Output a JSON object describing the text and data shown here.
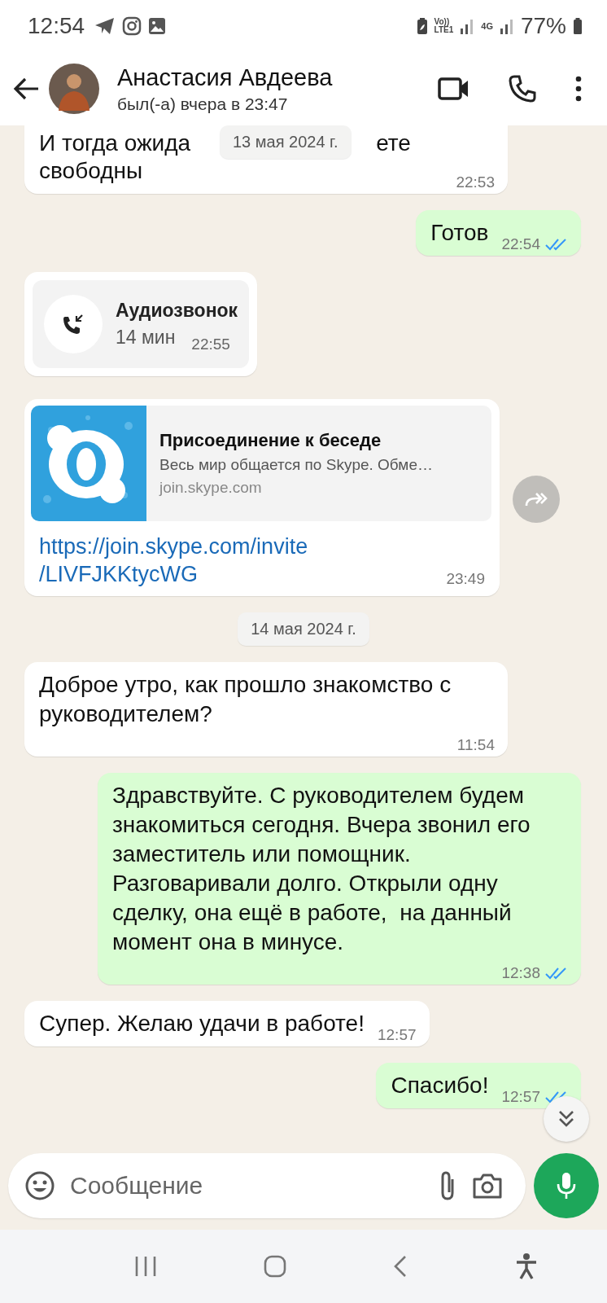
{
  "status_bar": {
    "time": "12:54",
    "volte_top": "Vo))",
    "volte_bottom": "LTE1",
    "network": "4G",
    "battery": "77%"
  },
  "header": {
    "name": "Анастасия Авдеева",
    "status": "был(-а) вчера в 23:47"
  },
  "floating_date": "13 мая 2024 г.",
  "messages": [
    {
      "kind": "partial",
      "outgoing": false,
      "line_start": "И тогда ожида",
      "line_end": "ете",
      "text": "свободны",
      "time": "22:53"
    },
    {
      "kind": "text",
      "outgoing": true,
      "text": "Готов",
      "time": "22:54",
      "read": true
    },
    {
      "kind": "call",
      "outgoing": false,
      "title": "Аудиозвонок",
      "duration": "14 мин",
      "time": "22:55"
    },
    {
      "kind": "link",
      "outgoing": false,
      "preview_title": "Присоединение к беседе",
      "preview_text": "Весь мир общается по Skype. Обме…",
      "preview_domain": "join.skype.com",
      "url_lines": [
        "https://join.skype.com/invite",
        "/LIVFJKKtycWG"
      ],
      "time": "23:49"
    },
    {
      "kind": "date",
      "text": "14 мая 2024 г."
    },
    {
      "kind": "text",
      "outgoing": false,
      "text": "Доброе утро, как прошло знакомство с руководителем?",
      "time": "11:54"
    },
    {
      "kind": "text",
      "outgoing": true,
      "text": "Здравствуйте. С руководителем будем знакомиться сегодня. Вчера звонил его заместитель или помощник. Разговаривали долго. Открыли одну сделку, она ещё в работе,  на данный момент она в минусе.",
      "time": "12:38",
      "read": true
    },
    {
      "kind": "text",
      "outgoing": false,
      "text": "Супер. Желаю удачи в работе!",
      "time": "12:57"
    },
    {
      "kind": "text",
      "outgoing": true,
      "text": "Спасибо!",
      "time": "12:57",
      "read": true
    }
  ],
  "composer": {
    "placeholder": "Сообщение"
  }
}
